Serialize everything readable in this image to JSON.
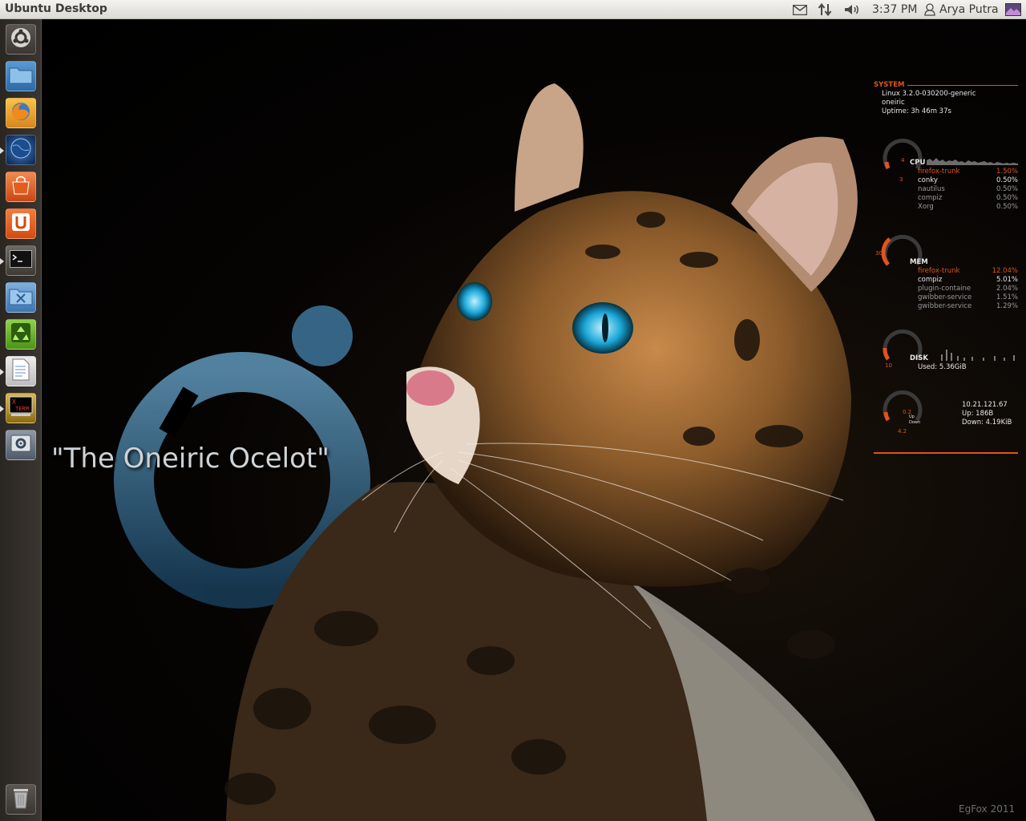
{
  "panel": {
    "title": "Ubuntu Desktop",
    "clock": "3:37 PM",
    "user": "Arya Putra",
    "indicators": [
      "mail-icon",
      "network-icon",
      "volume-icon",
      "user-icon",
      "session-icon"
    ]
  },
  "launcher": {
    "items": [
      "dash-home",
      "files",
      "firefox",
      "web-browser",
      "ubuntu-software",
      "ubuntu-one",
      "terminal",
      "system-tools",
      "recycle-app",
      "text-editor",
      "xterm",
      "system-settings",
      "trash"
    ]
  },
  "wallpaper": {
    "caption": "\"The Oneiric Ocelot\"",
    "signature": "EgFox 2011"
  },
  "conky": {
    "system": {
      "header": "SYSTEM",
      "kernel": "Linux 3.2.0-030200-generic",
      "codename": "oneiric",
      "uptime": "Uptime: 3h 46m 37s"
    },
    "cpu": {
      "header": "CPU",
      "gauge_labels": [
        "4",
        "3"
      ],
      "procs": [
        {
          "name": "firefox-trunk",
          "value": "1.50%"
        },
        {
          "name": "conky",
          "value": "0.50%"
        },
        {
          "name": "nautilus",
          "value": "0.50%"
        },
        {
          "name": "compiz",
          "value": "0.50%"
        },
        {
          "name": "Xorg",
          "value": "0.50%"
        }
      ]
    },
    "mem": {
      "header": "MEM",
      "gauge_label": "30",
      "procs": [
        {
          "name": "firefox-trunk",
          "value": "12.04%"
        },
        {
          "name": "compiz",
          "value": "5.01%"
        },
        {
          "name": "plugin-containe",
          "value": "2.04%"
        },
        {
          "name": "gwibber-service",
          "value": "1.51%"
        },
        {
          "name": "gwibber-service",
          "value": "1.29%"
        }
      ]
    },
    "disk": {
      "header": "DISK",
      "gauge_label": "10",
      "used": "Used: 5.36GiB"
    },
    "net": {
      "ip": "10.21.121.67",
      "up": "Up: 186B",
      "down": "Down: 4.19KiB",
      "gauge_labels": [
        "0.2",
        "4.2"
      ],
      "mini_labels": [
        "Up",
        "Down"
      ]
    }
  },
  "colors": {
    "accent": "#e0531f",
    "panel_bg": "#e8e6e1",
    "launcher_bg": "#2f2a26"
  }
}
